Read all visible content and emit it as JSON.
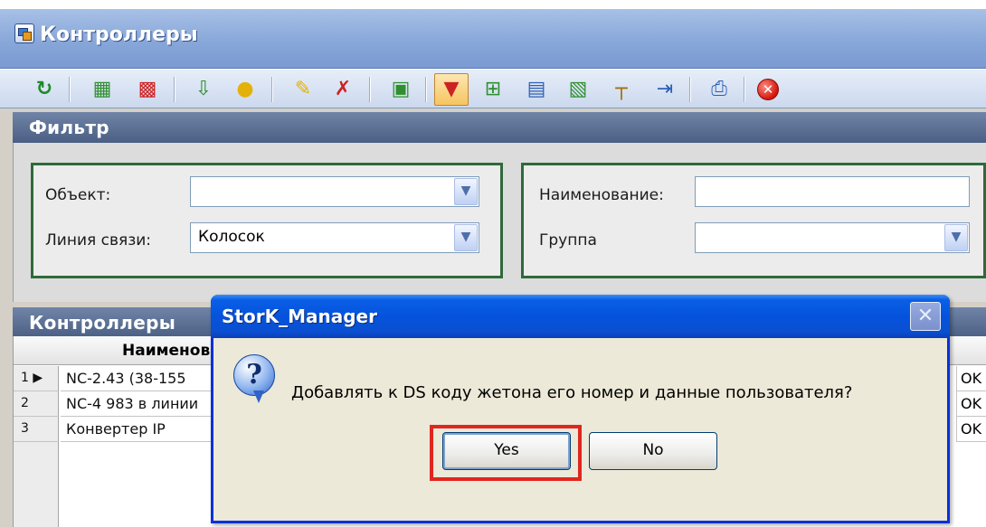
{
  "window": {
    "title": "Контроллеры"
  },
  "toolbar": {
    "icons": [
      "refresh-icon",
      "edit-icon",
      "delete-icon",
      "sort-icon",
      "lightbulb-icon",
      "pin-icon",
      "tools-icon",
      "export-icon",
      "filter-clear-icon",
      "add-row-icon",
      "table-icon",
      "image-icon",
      "ruler-icon",
      "align-icon",
      "print-icon",
      "close-icon"
    ]
  },
  "filter": {
    "header": "Фильтр",
    "object_label": "Объект:",
    "object_value": "",
    "line_label": "Линия связи:",
    "line_value": "Колосок",
    "name_label": "Наименование:",
    "name_value": "",
    "group_label": "Группа",
    "group_value": ""
  },
  "grid": {
    "header": "Контроллеры",
    "columns": [
      "Наименов"
    ],
    "rows": [
      {
        "index": "1",
        "name": "NC-2.43 (38-155",
        "status": "OK"
      },
      {
        "index": "2",
        "name": "NC-4 983 в линии",
        "status": "OK"
      },
      {
        "index": "3",
        "name": "Конвертер IP",
        "status": "OK"
      }
    ]
  },
  "dialog": {
    "title": "StorK_Manager",
    "message": "Добавлять к DS коду жетона его номер и данные пользователя?",
    "yes_label": "Yes",
    "no_label": "No",
    "close_glyph": "✕"
  },
  "colors": {
    "focus_highlight": "#e0261f",
    "dialog_title": "#0553dc",
    "panel_header": "#4a5f84"
  }
}
